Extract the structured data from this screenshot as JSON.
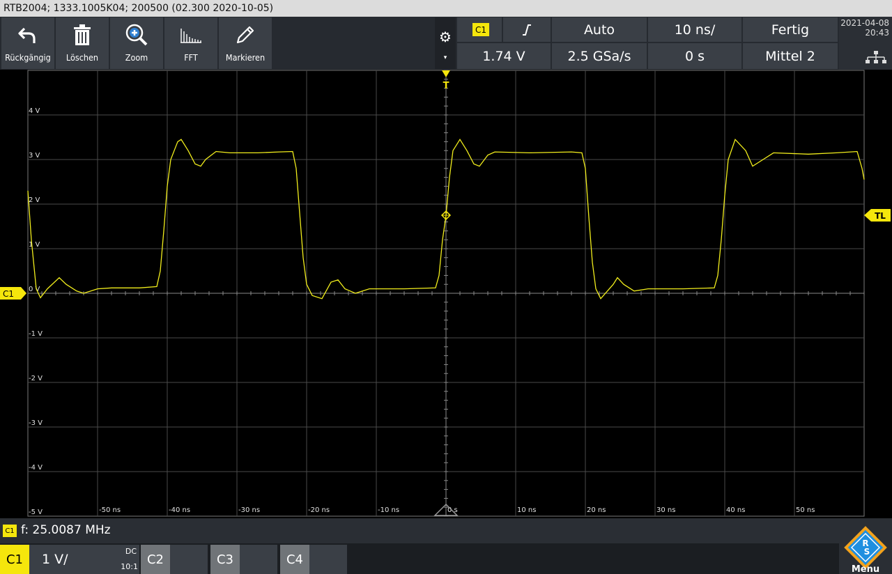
{
  "title": "RTB2004; 1333.1005K04; 200500 (02.300 2020-10-05)",
  "toolbar": {
    "undo": {
      "label": "Rückgängig",
      "icon": "undo-arrow-icon"
    },
    "delete": {
      "label": "Löschen",
      "icon": "trash-icon"
    },
    "zoom": {
      "label": "Zoom",
      "icon": "zoom-plus-icon"
    },
    "fft": {
      "label": "FFT",
      "icon": "fft-spectrum-icon"
    },
    "mark": {
      "label": "Markieren",
      "icon": "pencil-icon"
    }
  },
  "settings": {
    "gear_icon": "gear-icon",
    "arrow": "▾"
  },
  "trigger": {
    "source": "C1",
    "slope_icon": "rising-edge-icon",
    "mode": "Auto",
    "timebase": "10 ns/",
    "status": "Fertig",
    "level": "1.74 V",
    "sample_rate": "2.5 GSa/s",
    "position": "0 s",
    "acq_mode": "Mittel 2"
  },
  "datetime": {
    "date": "2021-04-08",
    "time": "20:43"
  },
  "network_icon": "lan-icon",
  "markers": {
    "trigger_top": "T",
    "trigger_level": "TL",
    "channel": "C1"
  },
  "y_axis_labels": [
    "4 V",
    "3 V",
    "2 V",
    "1 V",
    "0 V",
    "-1 V",
    "-2 V",
    "-3 V",
    "-4 V",
    "-5 V"
  ],
  "x_axis_labels": [
    "-50 ns",
    "-40 ns",
    "-30 ns",
    "-20 ns",
    "-10 ns",
    "0 s",
    "10 ns",
    "20 ns",
    "30 ns",
    "40 ns",
    "50 ns"
  ],
  "chart_data": {
    "type": "line",
    "title": "",
    "xlabel": "",
    "ylabel": "",
    "xlim": [
      -60,
      60
    ],
    "ylim": [
      -5,
      5
    ],
    "x_unit": "ns",
    "y_unit": "V",
    "grid": true,
    "series": [
      {
        "name": "C1",
        "color": "#f2ee1c",
        "description_points": [
          [
            -60,
            2.3
          ],
          [
            -59.5,
            1.2
          ],
          [
            -58.8,
            0.1
          ],
          [
            -58.2,
            -0.1
          ],
          [
            -57.2,
            0.1
          ],
          [
            -55.5,
            0.35
          ],
          [
            -54.5,
            0.2
          ],
          [
            -53,
            0.05
          ],
          [
            -52,
            0.0
          ],
          [
            -50,
            0.1
          ],
          [
            -48,
            0.12
          ],
          [
            -44,
            0.12
          ],
          [
            -41.5,
            0.15
          ],
          [
            -41,
            0.5
          ],
          [
            -40.5,
            1.4
          ],
          [
            -40,
            2.4
          ],
          [
            -39.5,
            3.0
          ],
          [
            -38.5,
            3.4
          ],
          [
            -38,
            3.45
          ],
          [
            -37,
            3.2
          ],
          [
            -36,
            2.9
          ],
          [
            -35.2,
            2.85
          ],
          [
            -34.5,
            3.0
          ],
          [
            -33,
            3.18
          ],
          [
            -31,
            3.15
          ],
          [
            -27,
            3.15
          ],
          [
            -24,
            3.17
          ],
          [
            -22,
            3.18
          ],
          [
            -21.5,
            2.8
          ],
          [
            -21,
            1.8
          ],
          [
            -20.5,
            0.8
          ],
          [
            -20,
            0.2
          ],
          [
            -19.2,
            -0.05
          ],
          [
            -17.8,
            -0.12
          ],
          [
            -16.5,
            0.25
          ],
          [
            -15.5,
            0.3
          ],
          [
            -14.5,
            0.1
          ],
          [
            -13,
            0.0
          ],
          [
            -11,
            0.1
          ],
          [
            -6,
            0.1
          ],
          [
            -1.5,
            0.12
          ],
          [
            -1,
            0.4
          ],
          [
            -0.5,
            1.2
          ],
          [
            0,
            1.74
          ],
          [
            0.5,
            2.6
          ],
          [
            1,
            3.2
          ],
          [
            2,
            3.45
          ],
          [
            3,
            3.2
          ],
          [
            4,
            2.9
          ],
          [
            4.8,
            2.85
          ],
          [
            6,
            3.1
          ],
          [
            7,
            3.17
          ],
          [
            12,
            3.15
          ],
          [
            18,
            3.17
          ],
          [
            19.5,
            3.15
          ],
          [
            20,
            2.8
          ],
          [
            20.5,
            1.7
          ],
          [
            21,
            0.7
          ],
          [
            21.5,
            0.1
          ],
          [
            22.2,
            -0.12
          ],
          [
            24,
            0.2
          ],
          [
            24.6,
            0.35
          ],
          [
            25.5,
            0.2
          ],
          [
            27,
            0.05
          ],
          [
            29,
            0.1
          ],
          [
            34,
            0.1
          ],
          [
            38.5,
            0.12
          ],
          [
            39,
            0.4
          ],
          [
            39.5,
            1.2
          ],
          [
            40,
            2.2
          ],
          [
            40.5,
            3.0
          ],
          [
            41.5,
            3.45
          ],
          [
            43,
            3.2
          ],
          [
            44,
            2.85
          ],
          [
            45.5,
            3.0
          ],
          [
            47,
            3.15
          ],
          [
            52,
            3.12
          ],
          [
            56,
            3.15
          ],
          [
            59,
            3.18
          ],
          [
            59.7,
            2.8
          ],
          [
            60,
            2.55
          ]
        ]
      }
    ]
  },
  "measurement": {
    "badge": "C1",
    "text": "f: 25.0087 MHz"
  },
  "channels": [
    {
      "tag": "C1",
      "scale": "1 V/",
      "coupling": "DC",
      "probe": "10:1"
    },
    {
      "tag": "C2"
    },
    {
      "tag": "C3"
    },
    {
      "tag": "C4"
    }
  ],
  "menu": {
    "label": "Menu",
    "icon": "rs-logo-icon"
  }
}
